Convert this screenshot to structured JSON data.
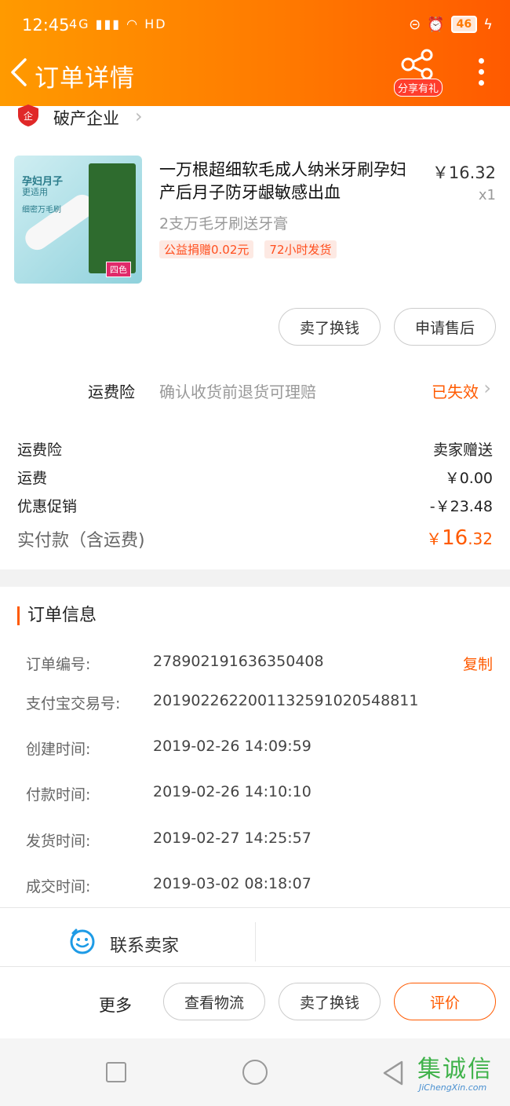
{
  "status_bar": {
    "time": "12:45",
    "network": "4G",
    "wifi_label": "HD",
    "battery": "46"
  },
  "nav": {
    "title": "订单详情",
    "share_badge": "分享有礼"
  },
  "shop": {
    "name": "破产企业",
    "icon_text": "企"
  },
  "product": {
    "title": "一万根超细软毛成人纳米牙刷孕妇产后月子防牙龈敏感出血",
    "price": "￥16.32",
    "quantity": "x1",
    "sku": "2支万毛牙刷送牙膏",
    "tags": [
      "公益捐赠0.02元",
      "72小时发货"
    ],
    "thumb_text1": "孕妇月子",
    "thumb_text2": "更适用",
    "thumb_text3": "细密万毛刷",
    "thumb_tag": "四色"
  },
  "product_actions": {
    "sell_label": "卖了换钱",
    "after_sale_label": "申请售后"
  },
  "insurance": {
    "label": "运费险",
    "desc": "确认收货前退货可理赔",
    "status": "已失效"
  },
  "fees": {
    "insurance_label": "运费险",
    "insurance_value": "卖家赠送",
    "shipping_label": "运费",
    "shipping_value": "￥0.00",
    "promo_label": "优惠促销",
    "promo_value": "-￥23.48",
    "total_label": "实付款（含运费)",
    "total_currency": "￥",
    "total_int": "16",
    "total_dec": ".32"
  },
  "order_info": {
    "title": "订单信息",
    "copy_label": "复制",
    "rows": [
      {
        "key": "订单编号:",
        "value": "278902191636350408"
      },
      {
        "key": "支付宝交易号:",
        "value": "2019022622001132591020548811"
      },
      {
        "key": "创建时间:",
        "value": "2019-02-26 14:09:59"
      },
      {
        "key": "付款时间:",
        "value": "2019-02-26 14:10:10"
      },
      {
        "key": "发货时间:",
        "value": "2019-02-27 14:25:57"
      },
      {
        "key": "成交时间:",
        "value": "2019-03-02 08:18:07"
      }
    ]
  },
  "contact": {
    "label": "联系卖家"
  },
  "bottom_actions": {
    "more_label": "更多",
    "logistics_label": "查看物流",
    "sell_label": "卖了换钱",
    "review_label": "评价"
  },
  "watermark": {
    "main": "集诚信",
    "sub": "JiChengXin.com"
  },
  "colors": {
    "accent": "#ff5a00",
    "header_start": "#ff9a00",
    "header_end": "#ff5a00"
  }
}
